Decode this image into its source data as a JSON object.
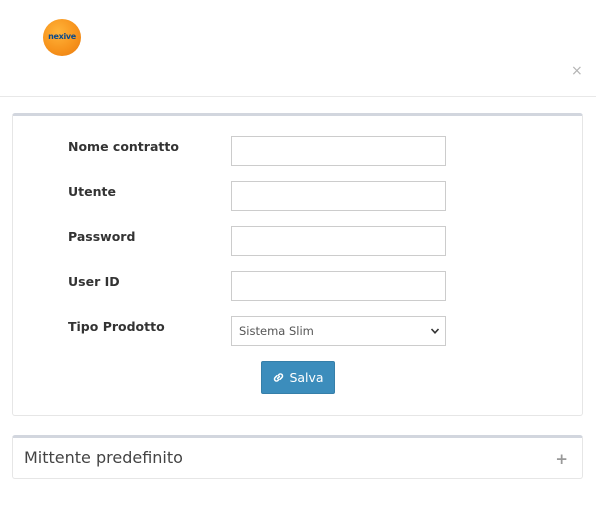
{
  "header": {
    "logo_text": "nexive",
    "close_symbol": "×"
  },
  "form": {
    "fields": [
      {
        "label": "Nome contratto",
        "value": "",
        "placeholder": ""
      },
      {
        "label": "Utente",
        "value": "",
        "placeholder": ""
      },
      {
        "label": "Password",
        "value": "",
        "placeholder": ""
      },
      {
        "label": "User ID",
        "value": "",
        "placeholder": ""
      }
    ],
    "product": {
      "label": "Tipo Prodotto",
      "selected": "Sistema Slim"
    },
    "save_label": "Salva"
  },
  "mittente": {
    "title": "Mittente predefinito",
    "expand_symbol": "+"
  },
  "colors": {
    "primary_button": "#3c8dbc",
    "logo_orange": "#f7941d",
    "logo_text_blue": "#0a4a8c"
  }
}
